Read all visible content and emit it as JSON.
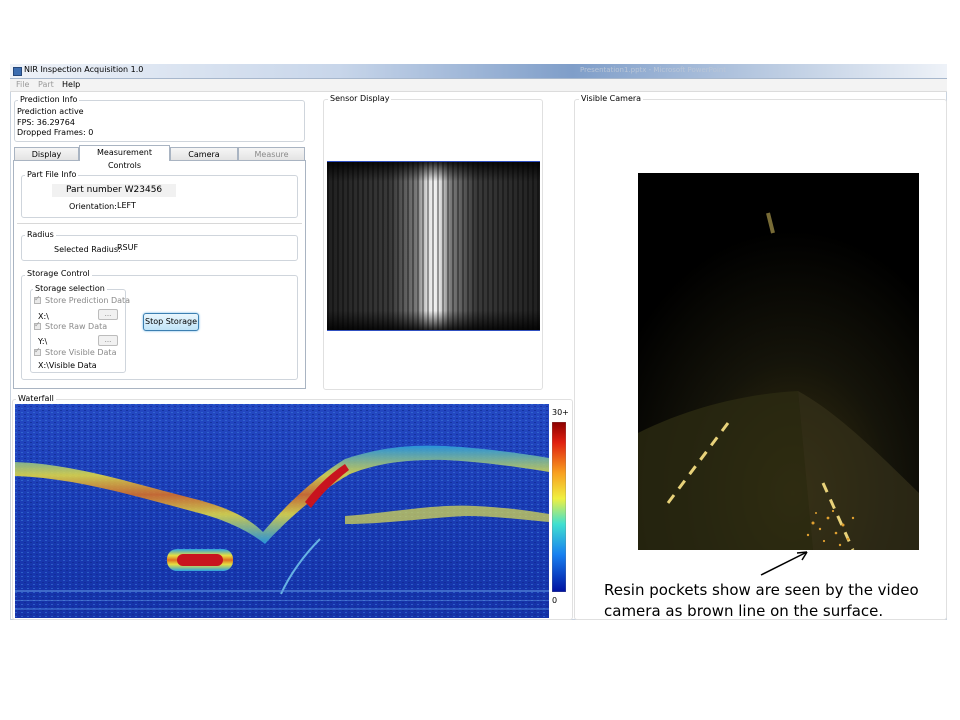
{
  "window": {
    "title": "NIR Inspection Acquisition 1.0",
    "background_task_ghost": "Presentation1.pptx - Microsoft PowerPoint"
  },
  "menu": {
    "items": [
      "File",
      "Part",
      "Help"
    ]
  },
  "prediction_info": {
    "title": "Prediction Info",
    "status": "Prediction active",
    "fps": "FPS: 36.29764",
    "dropped_frames": "Dropped Frames: 0"
  },
  "tabs": [
    {
      "label": "Display Settings",
      "state": "normal"
    },
    {
      "label": "Measurement Controls",
      "state": "active"
    },
    {
      "label": "Camera Controls",
      "state": "normal"
    },
    {
      "label": "Measure Sample",
      "state": "disabled"
    }
  ],
  "part_file_info": {
    "title": "Part File Info",
    "part_number": "Part number W23456",
    "orientation_label": "Orientation:",
    "orientation_value": "LEFT"
  },
  "radius": {
    "title": "Radius",
    "selected_label": "Selected Radius:",
    "selected_value": "RSUF"
  },
  "storage_control": {
    "title": "Storage Control",
    "selection_title": "Storage selection",
    "store_prediction": {
      "label": "Store Prediction Data",
      "checked": true,
      "path": "X:\\"
    },
    "store_raw": {
      "label": "Store Raw Data",
      "checked": true,
      "path": "Y:\\"
    },
    "store_visible": {
      "label": "Store Visible Data",
      "checked": true,
      "path": "X:\\Visible Data"
    },
    "browse_label": "...",
    "stop_button": "Stop Storage"
  },
  "sensor_display": {
    "title": "Sensor Display"
  },
  "visible_camera": {
    "title": "Visible Camera"
  },
  "waterfall": {
    "title": "Waterfall",
    "scale_max": "30+",
    "scale_min": "0"
  },
  "annotation": {
    "caption": "Resin pockets show are seen by the video camera as brown line on the surface."
  },
  "colors": {
    "accent_button": "#c1e4f8",
    "panel_border": "#cfd5dc",
    "waterfall_low": "#1a3cb4",
    "waterfall_high": "#c8141e"
  }
}
